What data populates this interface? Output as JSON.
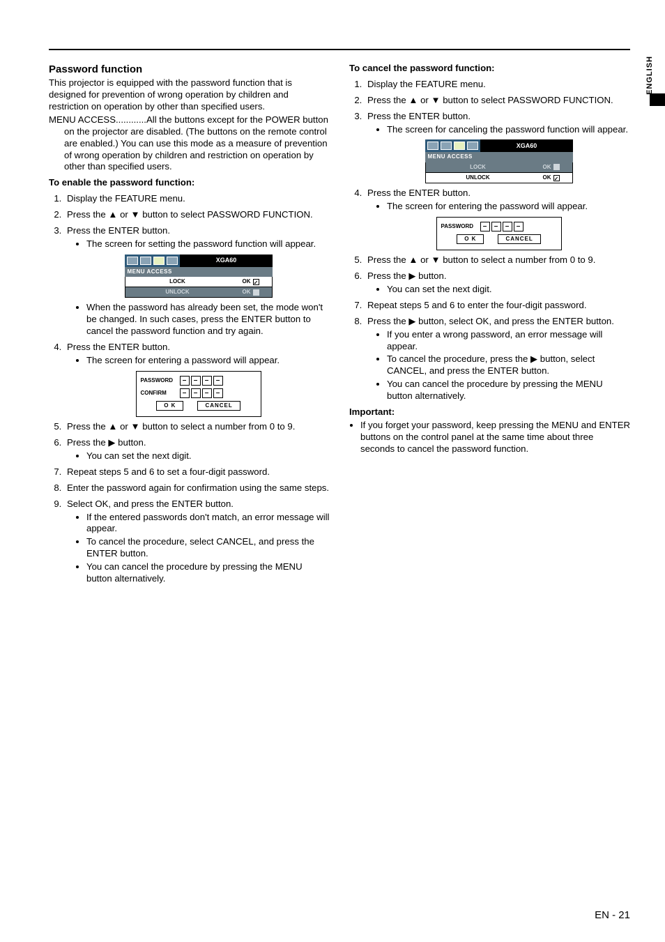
{
  "lang_tab": "ENGLISH",
  "footer": "EN - 21",
  "left": {
    "title": "Password function",
    "intro": "This projector is equipped with the password function that is designed for prevention of wrong operation by children and restriction on operation by other than specified users.",
    "menu_access": "MENU ACCESS............All the buttons except for the POWER button on the projector are disabled. (The buttons on the remote control are enabled.) You can use this mode as a measure of prevention of wrong operation by children and restriction on operation by other than specified users.",
    "enable_head": "To enable the password function:",
    "s1": "Display the FEATURE menu.",
    "s2": "Press the ▲ or ▼ button to select PASSWORD FUNCTION.",
    "s3": "Press the ENTER button.",
    "s3b1": "The screen for setting the password function will appear.",
    "menu1": {
      "title": "XGA60",
      "bar": "MENU ACCESS",
      "row1l": "LOCK",
      "row1r": "OK",
      "row2l": "UNLOCK",
      "row2r": "OK"
    },
    "s3b2": "When the password has already been set, the mode won't be changed. In such cases, press the ENTER button to cancel the password function and try again.",
    "s4": "Press the ENTER button.",
    "s4b1": "The screen for entering a password will appear.",
    "pw1": {
      "password": "PASSWORD",
      "confirm": "CONFIRM",
      "ok": "O K",
      "cancel": "CANCEL",
      "digit": "–"
    },
    "s5": "Press the ▲ or ▼ button to select a number from 0 to 9.",
    "s6": "Press the ▶ button.",
    "s6b1": "You can set the next digit.",
    "s7": "Repeat steps 5 and 6 to set a four-digit password.",
    "s8": "Enter the password again for confirmation using the same steps.",
    "s9": "Select OK, and press the ENTER button.",
    "s9b1": "If the entered passwords don't match, an error message will appear.",
    "s9b2": "To cancel the procedure, select CANCEL, and press the ENTER button.",
    "s9b3": "You can cancel the procedure by pressing the MENU button alternatively."
  },
  "right": {
    "cancel_head": "To cancel the password function:",
    "s1": "Display the FEATURE menu.",
    "s2": "Press the ▲ or ▼ button to select PASSWORD FUNCTION.",
    "s3": "Press the ENTER button.",
    "s3b1": "The screen for canceling the password function will appear.",
    "menu2": {
      "title": "XGA60",
      "bar": "MENU ACCESS",
      "row1l": "LOCK",
      "row1r": "OK",
      "row2l": "UNLOCK",
      "row2r": "OK"
    },
    "s4": "Press the ENTER button.",
    "s4b1": "The screen for entering the password will appear.",
    "pw2": {
      "password": "PASSWORD",
      "ok": "O K",
      "cancel": "CANCEL",
      "digit": "–"
    },
    "s5": "Press the ▲ or ▼ button to select a number from 0 to 9.",
    "s6": "Press the ▶ button.",
    "s6b1": "You can set the next digit.",
    "s7": "Repeat steps 5 and 6 to enter the four-digit password.",
    "s8": "Press the ▶ button, select OK, and press the ENTER button.",
    "s8b1": "If you enter a wrong password, an error message will appear.",
    "s8b2": "To cancel the procedure, press the ▶ button, select CANCEL, and press the ENTER button.",
    "s8b3": "You can cancel the procedure by pressing the MENU button alternatively.",
    "important_head": "Important:",
    "important1": "If you forget your password, keep pressing the MENU and ENTER buttons on the control panel at the same time about three seconds to cancel the password function."
  }
}
